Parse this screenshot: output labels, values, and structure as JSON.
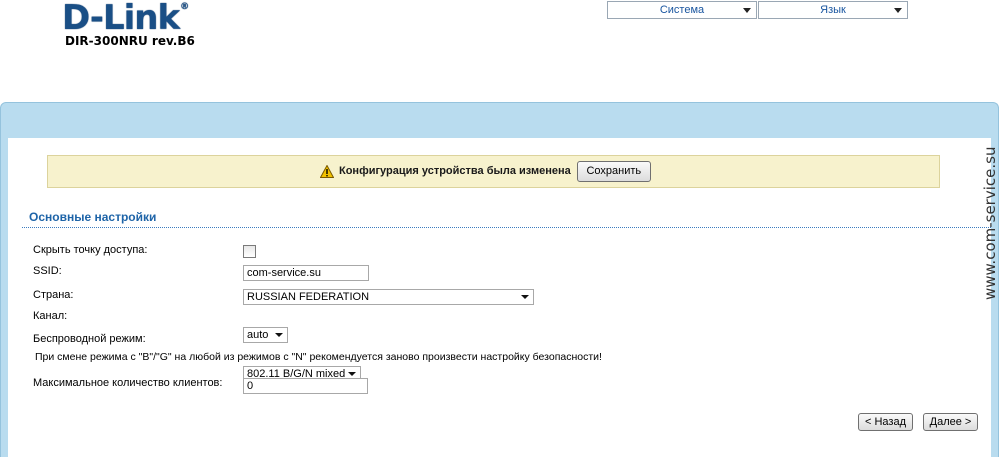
{
  "header": {
    "logo": "D-Link",
    "logo_reg": "®",
    "model": "DIR-300NRU rev.B6"
  },
  "top_menu": [
    {
      "label": "Система"
    },
    {
      "label": "Язык"
    }
  ],
  "notice": {
    "icon": "warning-icon",
    "text": "Конфигурация устройства была изменена",
    "save_label": "Сохранить"
  },
  "section": {
    "title": "Основные настройки"
  },
  "fields": {
    "hide_ap": {
      "label": "Скрыть точку доступа:",
      "checked": false
    },
    "ssid": {
      "label": "SSID:",
      "value": "com-service.su"
    },
    "country": {
      "label": "Страна:",
      "value": "RUSSIAN FEDERATION"
    },
    "channel": {
      "label": "Канал:",
      "value": "auto"
    },
    "mode": {
      "label": "Беспроводной режим:",
      "value": "802.11 B/G/N mixed"
    },
    "mode_hint": "При смене режима с \"B\"/\"G\" на любой из режимов с \"N\" рекомендуется заново произвести настройку безопасности!",
    "max_clients": {
      "label": "Максимальное количество клиентов:",
      "value": "0"
    }
  },
  "nav": {
    "back_label": "< Назад",
    "next_label": "Далее >"
  },
  "watermark": "www.com-service.su",
  "colors": {
    "panel": "#b9dcef",
    "notice_bg": "#f7f2cd",
    "section_title": "#1e64a8",
    "logo": "#1a4f86"
  }
}
